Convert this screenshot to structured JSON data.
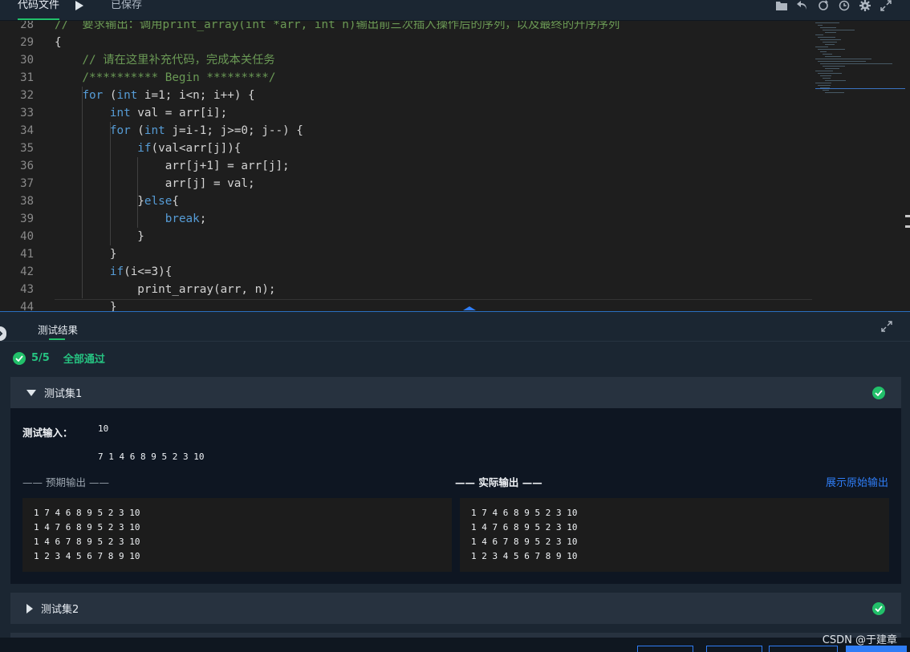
{
  "toolbar": {
    "code_tab": "代码文件",
    "saved_status": "已保存",
    "icons": [
      "folder-icon",
      "undo-icon",
      "refresh-icon",
      "history-icon",
      "gear-icon",
      "fullscreen-icon"
    ]
  },
  "editor": {
    "lines": [
      {
        "n": "28",
        "text": "//  要求输出：调用print_array(int *arr, int n)输出前三次插入操作后的序列，以及最终的升序序列"
      },
      {
        "n": "29",
        "text": "{"
      },
      {
        "n": "30",
        "text": "    // 请在这里补充代码，完成本关任务"
      },
      {
        "n": "31",
        "text": "    /********** Begin *********/"
      },
      {
        "n": "32",
        "text": "    for (int i=1; i<n; i++) {"
      },
      {
        "n": "33",
        "text": "        int val = arr[i];"
      },
      {
        "n": "34",
        "text": "        for (int j=i-1; j>=0; j--) {"
      },
      {
        "n": "35",
        "text": "            if(val<arr[j]){"
      },
      {
        "n": "36",
        "text": "                arr[j+1] = arr[j];"
      },
      {
        "n": "37",
        "text": "                arr[j] = val;"
      },
      {
        "n": "38",
        "text": "            }else{"
      },
      {
        "n": "39",
        "text": "                break;"
      },
      {
        "n": "40",
        "text": "            }"
      },
      {
        "n": "41",
        "text": "        }"
      },
      {
        "n": "42",
        "text": "        if(i<=3){"
      },
      {
        "n": "43",
        "text": "            print_array(arr, n);"
      },
      {
        "n": "44",
        "text": "        }"
      }
    ]
  },
  "panel": {
    "tab_label": "测试结果",
    "summary_count": "5/5",
    "summary_text": "全部通过",
    "sets": [
      {
        "title": "测试集1",
        "expanded": true,
        "input_label": "测试输入：",
        "input_lines": [
          "10",
          "7 1 4 6 8 9 5 2 3 10"
        ],
        "expected_label": "—— 预期输出 ——",
        "actual_label": "—— 实际输出 ——",
        "raw_link": "展示原始输出",
        "expected": [
          "1 7 4 6 8 9 5 2 3 10",
          "1 4 7 6 8 9 5 2 3 10",
          "1 4 6 7 8 9 5 2 3 10",
          "1 2 3 4 5 6 7 8 9 10"
        ],
        "actual": [
          "1 7 4 6 8 9 5 2 3 10",
          "1 4 7 6 8 9 5 2 3 10",
          "1 4 6 7 8 9 5 2 3 10",
          "1 2 3 4 5 6 7 8 9 10"
        ]
      },
      {
        "title": "测试集2",
        "expanded": false
      }
    ]
  },
  "watermark": "CSDN @于建章",
  "colors": {
    "accent_green": "#22c06a",
    "link_blue": "#2f7df6",
    "editor_bg": "#1e1e1e",
    "panel_bg": "#1b2632"
  }
}
